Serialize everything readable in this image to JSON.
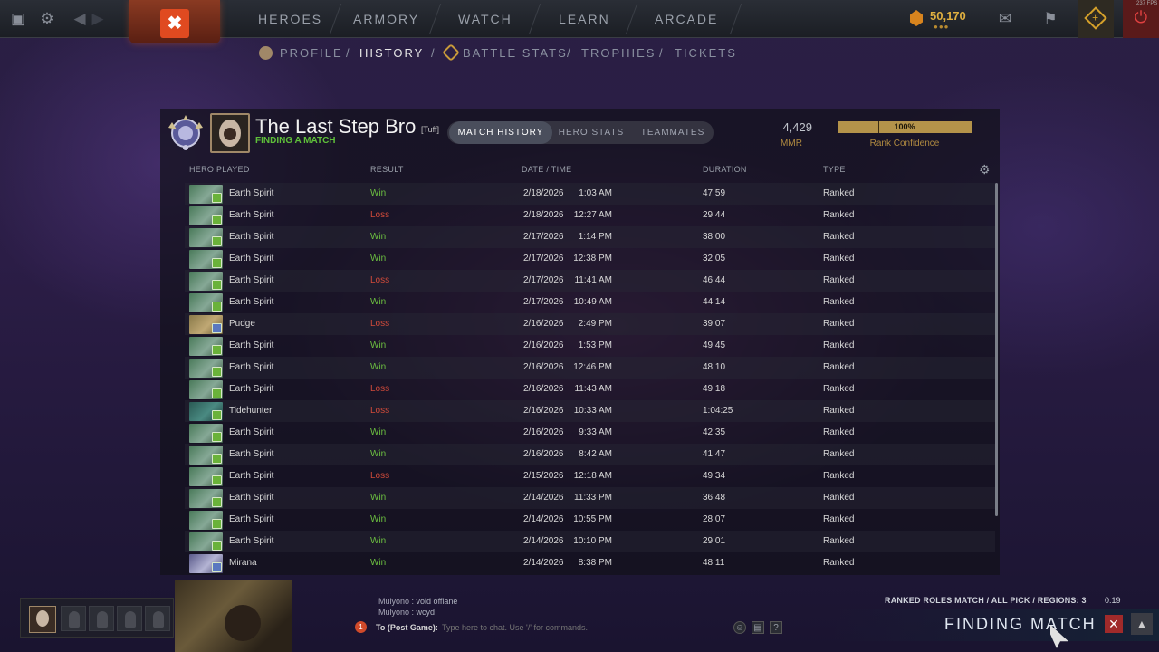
{
  "topbar": {
    "nav": [
      "HEROES",
      "ARMORY",
      "WATCH",
      "LEARN",
      "ARCADE"
    ],
    "currency": "50,170",
    "fps": "237 FPS"
  },
  "subnav": {
    "items": [
      "PROFILE",
      "HISTORY",
      "BATTLE STATS",
      "TROPHIES",
      "TICKETS"
    ],
    "active": "HISTORY"
  },
  "profile": {
    "name": "The Last Step Bro",
    "tag": "[Tuff]",
    "status": "FINDING A MATCH",
    "tabs": [
      "MATCH HISTORY",
      "HERO STATS",
      "TEAMMATES"
    ],
    "active_tab": "MATCH HISTORY",
    "mmr_value": "4,429",
    "mmr_label": "MMR",
    "confidence_value": "100%",
    "confidence_fraction": 1.0,
    "confidence_label": "Rank Confidence"
  },
  "table": {
    "headers": [
      "HERO PLAYED",
      "RESULT",
      "DATE / TIME",
      "DURATION",
      "TYPE"
    ],
    "rows": [
      {
        "hero": "Earth Spirit",
        "icon": "es",
        "result": "Win",
        "date": "2/18/2026",
        "time": "1:03 AM",
        "duration": "47:59",
        "type": "Ranked"
      },
      {
        "hero": "Earth Spirit",
        "icon": "es",
        "result": "Loss",
        "date": "2/18/2026",
        "time": "12:27 AM",
        "duration": "29:44",
        "type": "Ranked"
      },
      {
        "hero": "Earth Spirit",
        "icon": "es",
        "result": "Win",
        "date": "2/17/2026",
        "time": "1:14 PM",
        "duration": "38:00",
        "type": "Ranked"
      },
      {
        "hero": "Earth Spirit",
        "icon": "es",
        "result": "Win",
        "date": "2/17/2026",
        "time": "12:38 PM",
        "duration": "32:05",
        "type": "Ranked"
      },
      {
        "hero": "Earth Spirit",
        "icon": "es",
        "result": "Loss",
        "date": "2/17/2026",
        "time": "11:41 AM",
        "duration": "46:44",
        "type": "Ranked"
      },
      {
        "hero": "Earth Spirit",
        "icon": "es",
        "result": "Win",
        "date": "2/17/2026",
        "time": "10:49 AM",
        "duration": "44:14",
        "type": "Ranked"
      },
      {
        "hero": "Pudge",
        "icon": "pu",
        "result": "Loss",
        "date": "2/16/2026",
        "time": "2:49 PM",
        "duration": "39:07",
        "type": "Ranked"
      },
      {
        "hero": "Earth Spirit",
        "icon": "es",
        "result": "Win",
        "date": "2/16/2026",
        "time": "1:53 PM",
        "duration": "49:45",
        "type": "Ranked"
      },
      {
        "hero": "Earth Spirit",
        "icon": "es",
        "result": "Win",
        "date": "2/16/2026",
        "time": "12:46 PM",
        "duration": "48:10",
        "type": "Ranked"
      },
      {
        "hero": "Earth Spirit",
        "icon": "es",
        "result": "Loss",
        "date": "2/16/2026",
        "time": "11:43 AM",
        "duration": "49:18",
        "type": "Ranked"
      },
      {
        "hero": "Tidehunter",
        "icon": "ti",
        "result": "Loss",
        "date": "2/16/2026",
        "time": "10:33 AM",
        "duration": "1:04:25",
        "type": "Ranked"
      },
      {
        "hero": "Earth Spirit",
        "icon": "es",
        "result": "Win",
        "date": "2/16/2026",
        "time": "9:33 AM",
        "duration": "42:35",
        "type": "Ranked"
      },
      {
        "hero": "Earth Spirit",
        "icon": "es",
        "result": "Win",
        "date": "2/16/2026",
        "time": "8:42 AM",
        "duration": "41:47",
        "type": "Ranked"
      },
      {
        "hero": "Earth Spirit",
        "icon": "es",
        "result": "Loss",
        "date": "2/15/2026",
        "time": "12:18 AM",
        "duration": "49:34",
        "type": "Ranked"
      },
      {
        "hero": "Earth Spirit",
        "icon": "es",
        "result": "Win",
        "date": "2/14/2026",
        "time": "11:33 PM",
        "duration": "36:48",
        "type": "Ranked"
      },
      {
        "hero": "Earth Spirit",
        "icon": "es",
        "result": "Win",
        "date": "2/14/2026",
        "time": "10:55 PM",
        "duration": "28:07",
        "type": "Ranked"
      },
      {
        "hero": "Earth Spirit",
        "icon": "es",
        "result": "Win",
        "date": "2/14/2026",
        "time": "10:10 PM",
        "duration": "29:01",
        "type": "Ranked"
      },
      {
        "hero": "Mirana",
        "icon": "mi",
        "result": "Win",
        "date": "2/14/2026",
        "time": "8:38 PM",
        "duration": "48:11",
        "type": "Ranked"
      }
    ]
  },
  "chat": {
    "lines": [
      {
        "who": "Mulyono",
        "text": "void offlane"
      },
      {
        "who": "Mulyono",
        "text": "wcyd"
      }
    ],
    "alert_count": "1",
    "channel": "To (Post Game):",
    "placeholder": "Type here to chat. Use '/' for commands."
  },
  "matchmaking": {
    "info": "RANKED ROLES MATCH  /  ALL PICK  /  REGIONS: 3",
    "timer": "0:19",
    "status": "FINDING MATCH"
  },
  "colors": {
    "win": "#6cc040",
    "loss": "#d04a3a",
    "gold": "#b4934a"
  }
}
